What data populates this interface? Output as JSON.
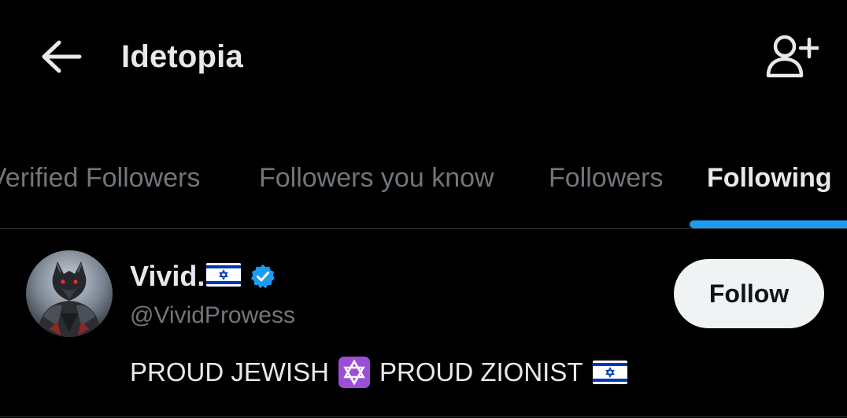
{
  "header": {
    "title": "Idetopia",
    "back_icon": "arrow-left-icon",
    "add_user_icon": "person-add-icon"
  },
  "tabs": [
    {
      "label": "Verified Followers",
      "active": false
    },
    {
      "label": "Followers you know",
      "active": false
    },
    {
      "label": "Followers",
      "active": false
    },
    {
      "label": "Following",
      "active": true
    }
  ],
  "users": [
    {
      "display_name": "Vivid.",
      "name_flag": "israel-flag-icon",
      "verified_icon": "verified-badge-icon",
      "handle": "@VividProwess",
      "bio": {
        "part1": "PROUD JEWISH",
        "emoji1": "star-of-david-icon",
        "part2": "PROUD ZIONIST",
        "emoji2": "israel-flag-icon"
      },
      "follow_label": "Follow"
    }
  ],
  "colors": {
    "background": "#000000",
    "text_primary": "#e7e9ea",
    "text_secondary": "#71767b",
    "accent": "#1d9bf0",
    "button_bg": "#eff3f4",
    "divider": "#2f3336"
  }
}
